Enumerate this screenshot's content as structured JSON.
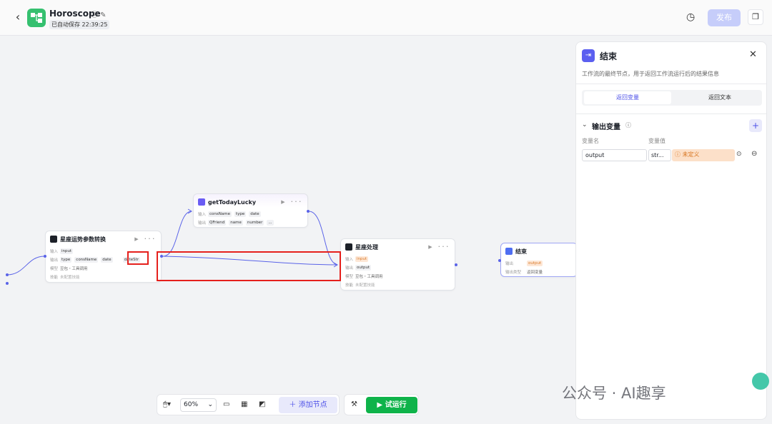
{
  "header": {
    "title": "Horoscope",
    "saved": "已自动保存 22:39:25",
    "publish_label": "发布"
  },
  "nodes": {
    "transform": {
      "title": "星座运势参数转换",
      "input_label": "输入",
      "input_tag": "input",
      "output_label": "输出",
      "output_tags": [
        "type",
        "consName",
        "date",
        "dateStr"
      ],
      "model_label": "模型",
      "model_value": "豆包・工具调用",
      "skill_label": "技能",
      "skill_value": "未配置技能"
    },
    "lucky": {
      "title": "getTodayLucky",
      "input_label": "输入",
      "input_tags": [
        "consName",
        "type",
        "date"
      ],
      "output_label": "输出",
      "output_tags": [
        "QFriend",
        "name",
        "number",
        "..."
      ]
    },
    "process": {
      "title": "星座处理",
      "input_label": "输入",
      "input_tag": "input",
      "output_label": "输出",
      "output_tag": "output",
      "model_label": "模型",
      "model_value": "豆包・工具调用",
      "skill_label": "技能",
      "skill_value": "未配置技能"
    },
    "end": {
      "title": "结束",
      "output_label": "输出",
      "output_tag": "output",
      "type_label": "输出类型",
      "type_value": "返回变量"
    }
  },
  "panel": {
    "title": "结束",
    "description": "工作流的最终节点，用于返回工作流运行后的结果信息",
    "tabs": [
      "返回变量",
      "返回文本"
    ],
    "section_title": "输出变量",
    "col_name": "变量名",
    "col_value": "变量值",
    "var_name": "output",
    "var_type": "str...",
    "var_value": "未定义"
  },
  "toolbar": {
    "zoom": "60%",
    "add_node": "添加节点",
    "run": "试运行"
  },
  "watermark": "公众号 · AI趣享",
  "colors": {
    "primary": "#4e52e8",
    "run": "#0fb34a",
    "annotation": "#e5201c",
    "undefined_bg": "#fce0c9"
  }
}
